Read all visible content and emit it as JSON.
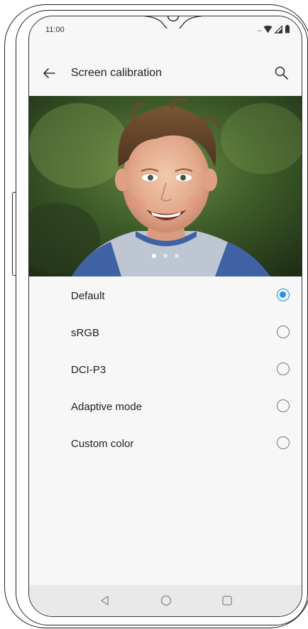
{
  "status_bar": {
    "time": "11:00",
    "overflow": "..."
  },
  "app_bar": {
    "title": "Screen calibration",
    "back_icon": "arrow-left-icon",
    "search_icon": "search-icon"
  },
  "preview": {
    "description_icon": "photo",
    "pages": 3,
    "active_page": 1
  },
  "options": [
    {
      "label": "Default",
      "selected": true
    },
    {
      "label": "sRGB",
      "selected": false
    },
    {
      "label": "DCI-P3",
      "selected": false
    },
    {
      "label": "Adaptive mode",
      "selected": false
    },
    {
      "label": "Custom color",
      "selected": false
    }
  ],
  "nav_bar": {
    "back": "triangle-back-icon",
    "home": "circle-home-icon",
    "recents": "square-recents-icon"
  },
  "colors": {
    "accent": "#1f8ff0",
    "background": "#f7f7f7",
    "nav_bar": "#e9e9e9"
  }
}
